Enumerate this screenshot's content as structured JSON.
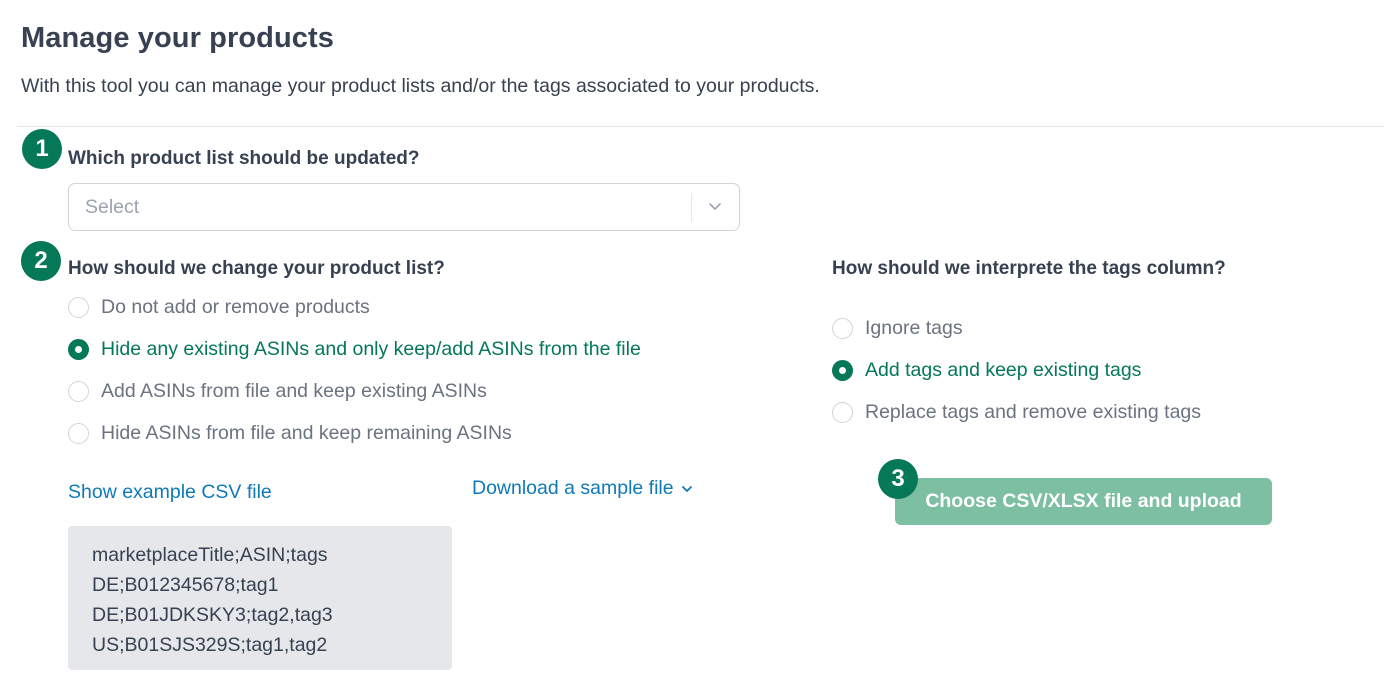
{
  "page": {
    "title": "Manage your products",
    "subtitle": "With this tool you can manage your product lists and/or the tags associated to your products."
  },
  "steps": [
    "1",
    "2",
    "3"
  ],
  "product_list": {
    "heading": "Which product list should be updated?",
    "select_placeholder": "Select"
  },
  "change_list": {
    "heading": "How should we change your product list?",
    "options": [
      {
        "label": "Do not add or remove products",
        "selected": false
      },
      {
        "label": "Hide any existing ASINs and only keep/add ASINs from the file",
        "selected": true
      },
      {
        "label": "Add ASINs from file and keep existing ASINs",
        "selected": false
      },
      {
        "label": "Hide ASINs from file and keep remaining ASINs",
        "selected": false
      }
    ]
  },
  "tags": {
    "heading": "How should we interprete the tags column?",
    "options": [
      {
        "label": "Ignore tags",
        "selected": false
      },
      {
        "label": "Add tags and keep existing tags",
        "selected": true
      },
      {
        "label": "Replace tags and remove existing tags",
        "selected": false
      }
    ]
  },
  "links": {
    "show_example": "Show example CSV file",
    "download_sample": "Download a sample file"
  },
  "example_csv": {
    "lines": [
      "marketplaceTitle;ASIN;tags",
      "DE;B012345678;tag1",
      "DE;B01JDKSKY3;tag2,tag3",
      "US;B01SJS329S;tag1,tag2"
    ]
  },
  "upload": {
    "label": "Choose CSV/XLSX file and upload"
  },
  "colors": {
    "accent": "#047857",
    "link": "#0e7ab8",
    "button_disabled": "#7cbfa3"
  },
  "icons": {
    "select_chevron": "chevron-down-icon",
    "download_chevron": "chevron-down-icon"
  }
}
